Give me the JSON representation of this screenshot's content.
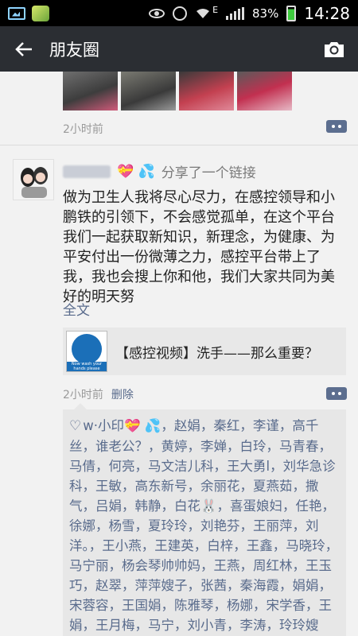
{
  "statusbar": {
    "network_type": "E",
    "battery": "83%",
    "time": "14:28"
  },
  "header": {
    "title": "朋友圈"
  },
  "post1": {
    "time": "2小时前"
  },
  "post2": {
    "author_suffix": "💝 💦",
    "shared_label": "分享了一个链接",
    "text": "做为卫生人我将尽心尽力，在感控领导和小鹏铁的引领下，不会感觉孤单，在这个平台我们一起获取新知识，新理念，为健康、为平安付出一份微薄之力，感控平台带上了我，我也会搜上你和他，我们大家共同为美好的明天努",
    "expand_label": "全文",
    "link_title": "【感控视频】洗手——那么重要？",
    "link_thumb_text": "Now wash your hands please",
    "time": "2小时前",
    "delete_label": "删除",
    "likes": "w·小印💝 💦，赵娟，秦红，李谨，高千丝，谁老公？，黄婷，李婵，白玲，马青春，马倩，何亮，马文洁儿科，王大勇l，刘华急诊科，王敏，高东新号，余丽花，夏燕茹，撒气，吕娟，韩静，白花🐰，喜蛋娘妇，任艳，徐娜，杨雪，夏玲玲，刘艳芬，王丽萍，刘洋。，王小燕，王建英，白梓，王鑫，马晓玲，马宁丽，杨会琴帅帅妈，王燕，周红林，王玉巧，赵翠，萍萍嫂子，张茜，秦海霞，娟娟，宋蓉容，王国娟，陈雅琴，杨娜，宋学香，王娟，王月梅，马宁，刘小青，李涛，玲玲嫂子，李银花"
  },
  "colors": {
    "titlebar": "#2b2e33",
    "link": "#596b8c",
    "background": "#f2f2f2"
  },
  "icons": [
    "back-arrow-icon",
    "camera-icon",
    "comment-icon",
    "heart-icon",
    "eye-icon",
    "alarm-icon",
    "wifi-icon",
    "signal-icon",
    "battery-icon"
  ]
}
